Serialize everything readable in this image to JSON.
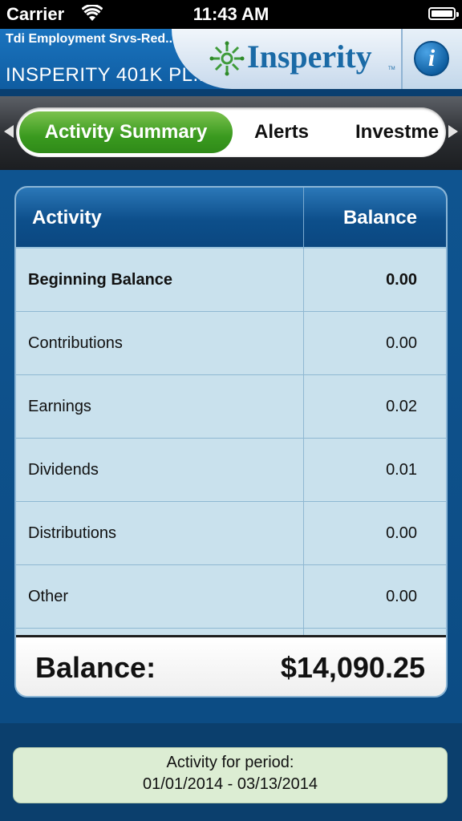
{
  "status_bar": {
    "carrier": "Carrier",
    "time": "11:43 AM"
  },
  "header": {
    "employer": "Tdi Employment Srvs-Red...",
    "plan": "INSPERITY 401K PL...",
    "logo_text": "Insperity",
    "logo_tm": "TM",
    "info_symbol": "i",
    "brand_color": "#1a6aa6"
  },
  "tabs": [
    {
      "label": "Activity Summary",
      "active": true
    },
    {
      "label": "Alerts",
      "active": false
    },
    {
      "label": "Investme",
      "active": false
    }
  ],
  "table": {
    "columns": [
      "Activity",
      "Balance"
    ],
    "rows": [
      {
        "activity": "Beginning Balance",
        "balance": "0.00",
        "bold": true
      },
      {
        "activity": "Contributions",
        "balance": "0.00",
        "bold": false
      },
      {
        "activity": "Earnings",
        "balance": "0.02",
        "bold": false
      },
      {
        "activity": "Dividends",
        "balance": "0.01",
        "bold": false
      },
      {
        "activity": "Distributions",
        "balance": "0.00",
        "bold": false
      },
      {
        "activity": "Other",
        "balance": "0.00",
        "bold": false
      }
    ]
  },
  "total": {
    "label": "Balance:",
    "value": "$14,090.25"
  },
  "period": {
    "title": "Activity for period:",
    "range": "01/01/2014 - 03/13/2014"
  },
  "colors": {
    "accent_green": "#3a9a1f",
    "header_blue": "#0d4f8b",
    "table_bg": "#c9e1ed",
    "period_bg": "#dcedd3"
  }
}
